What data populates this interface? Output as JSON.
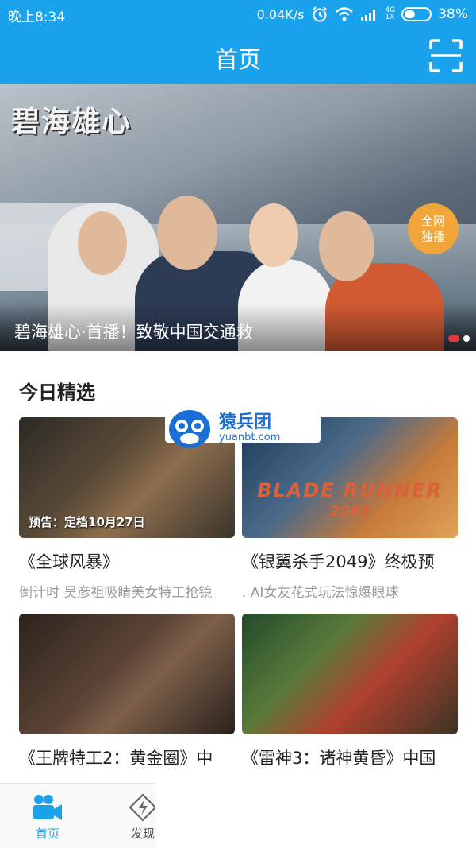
{
  "status_bar": {
    "time": "晚上8:34",
    "speed": "0.04K/s",
    "network_label_top": "4G",
    "network_label_bottom": "1X",
    "battery": "38%"
  },
  "header": {
    "title": "首页",
    "scan_icon": "scan-icon"
  },
  "banner": {
    "logo_text": "碧海雄心",
    "badge": "全网独播",
    "caption": "碧海雄心·首播！致敬中国交通救",
    "slide_count": 2,
    "active_slide": 1
  },
  "section": {
    "title": "今日精选"
  },
  "cards": [
    {
      "tag": "预告：定档10月27日",
      "title": "《全球风暴》",
      "subtitle": "倒计时 吴彦祖吸睛美女特工抢镜"
    },
    {
      "tag": "",
      "poster_text": "BLADE RUNNER",
      "poster_sub": "2049",
      "title": "《银翼杀手2049》终极预",
      "subtitle": ". AI女友花式玩法惊爆眼球"
    },
    {
      "tag": "",
      "title": "《王牌特工2：黄金圈》中",
      "subtitle": ""
    },
    {
      "tag": "",
      "title": "《雷神3：诸神黄昏》中国",
      "subtitle": ""
    }
  ],
  "watermark": {
    "cn": "猿兵团",
    "en": "yuanbt.com"
  },
  "tabbar": {
    "items": [
      {
        "label": "首页",
        "icon": "video-camera-icon",
        "active": true
      },
      {
        "label": "发现",
        "icon": "discover-icon",
        "active": false
      }
    ]
  },
  "colors": {
    "primary": "#1aa3ec",
    "active_dot": "#e23b3b"
  }
}
